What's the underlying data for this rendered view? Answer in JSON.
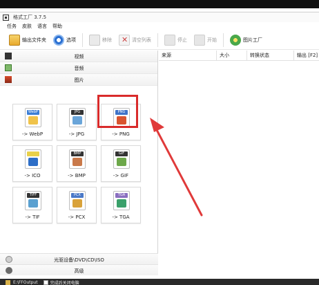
{
  "window": {
    "title": "格式工厂 3.7.5"
  },
  "menu": [
    "任务",
    "皮肤",
    "语言",
    "帮助"
  ],
  "toolbar": {
    "output_folder": "输出文件夹",
    "options": "选项",
    "remove": "移除",
    "clear_list": "清空列表",
    "stop": "停止",
    "start": "开始",
    "image_tool": "图片工厂"
  },
  "categories": {
    "video": "视频",
    "audio": "音频",
    "image": "图片"
  },
  "formats": [
    {
      "label": "-> WebP",
      "tag": "WebP",
      "tag_color": "#3b7ed6",
      "art_color": "#f0c34a"
    },
    {
      "label": "-> JPG",
      "tag": "JPG",
      "tag_color": "#333333",
      "art_color": "#6aa5d9"
    },
    {
      "label": "-> PNG",
      "tag": "PNG",
      "tag_color": "#3f73c8",
      "art_color": "#d9542f"
    },
    {
      "label": "-> ICO",
      "tag": "",
      "tag_color": "#e8d04a",
      "art_color": "#2d6ec7"
    },
    {
      "label": "-> BMP",
      "tag": "BMP",
      "tag_color": "#333333",
      "art_color": "#c9794a"
    },
    {
      "label": "-> GIF",
      "tag": "GIF",
      "tag_color": "#333333",
      "art_color": "#6da84a"
    },
    {
      "label": "-> TIF",
      "tag": "TIFF",
      "tag_color": "#333333",
      "art_color": "#5aa0d0"
    },
    {
      "label": "-> PCX",
      "tag": "PCX",
      "tag_color": "#4a78c7",
      "art_color": "#d9a23a"
    },
    {
      "label": "-> TGA",
      "tag": "TGA",
      "tag_color": "#8a6fc0",
      "art_color": "#3aa06a"
    }
  ],
  "bottom": {
    "optical": "光驱设备\\DVD\\CD\\ISO",
    "advanced": "高级"
  },
  "columns": {
    "source": "来源",
    "size": "大小",
    "status": "转换状态",
    "output": "输出 [F2]"
  },
  "statusbar": {
    "path": "E:\\FFOutput",
    "option": "完成后关闭电脑"
  },
  "colors": {
    "highlight": "#d92b2b",
    "arrow": "#e03a3a"
  }
}
